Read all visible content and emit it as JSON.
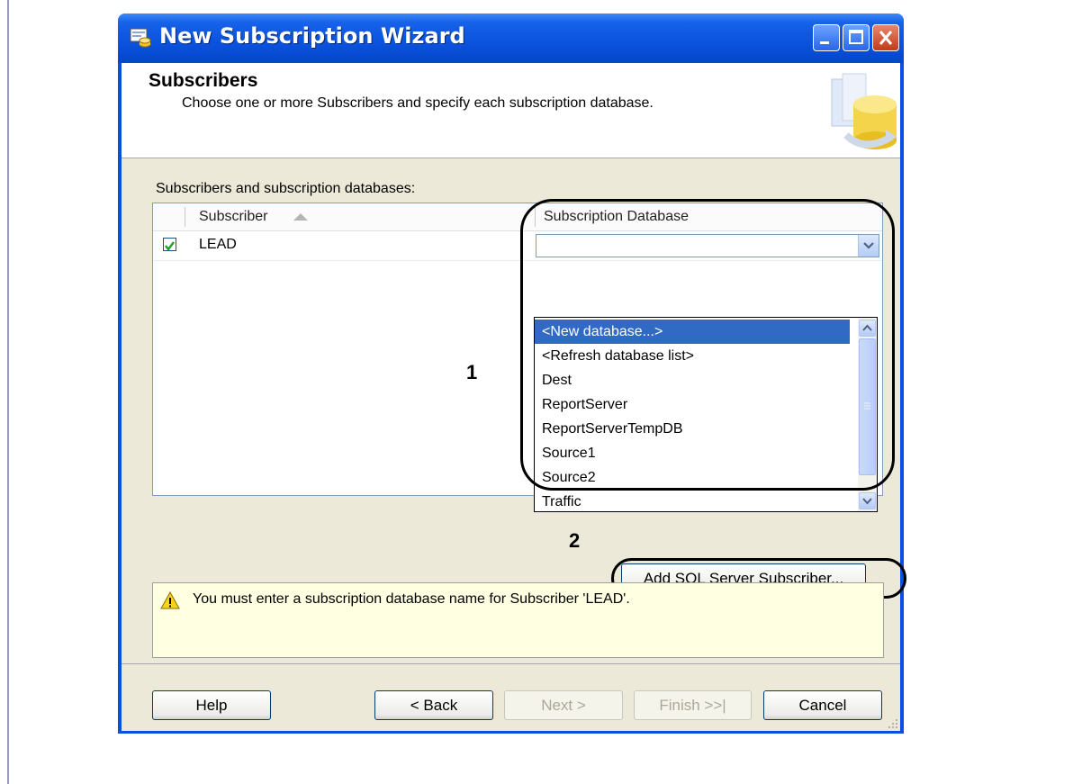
{
  "window": {
    "title": "New Subscription Wizard"
  },
  "header": {
    "title": "Subscribers",
    "subtitle": "Choose one or more Subscribers and specify each subscription database."
  },
  "list": {
    "label": "Subscribers and subscription databases:",
    "columns": {
      "subscriber": "Subscriber",
      "database": "Subscription Database"
    },
    "rows": [
      {
        "checked": true,
        "subscriber": "LEAD",
        "database": ""
      }
    ]
  },
  "dropdown": {
    "selected_index": 0,
    "options": [
      "<New database...>",
      "<Refresh database list>",
      "Dest",
      "ReportServer",
      "ReportServerTempDB",
      "Source1",
      "Source2",
      "Traffic"
    ]
  },
  "annotations": {
    "first": "1",
    "second": "2"
  },
  "add_button": {
    "label": "Add SQL Server Subscriber..."
  },
  "message": {
    "text": "You must enter a subscription database name for Subscriber 'LEAD'."
  },
  "buttons": {
    "help": "Help",
    "back": "< Back",
    "next": "Next >",
    "finish": "Finish >>|",
    "cancel": "Cancel"
  },
  "colors": {
    "titlebar": "#0a52dd",
    "selection": "#316ac5",
    "message_bg": "#ffffe1"
  }
}
